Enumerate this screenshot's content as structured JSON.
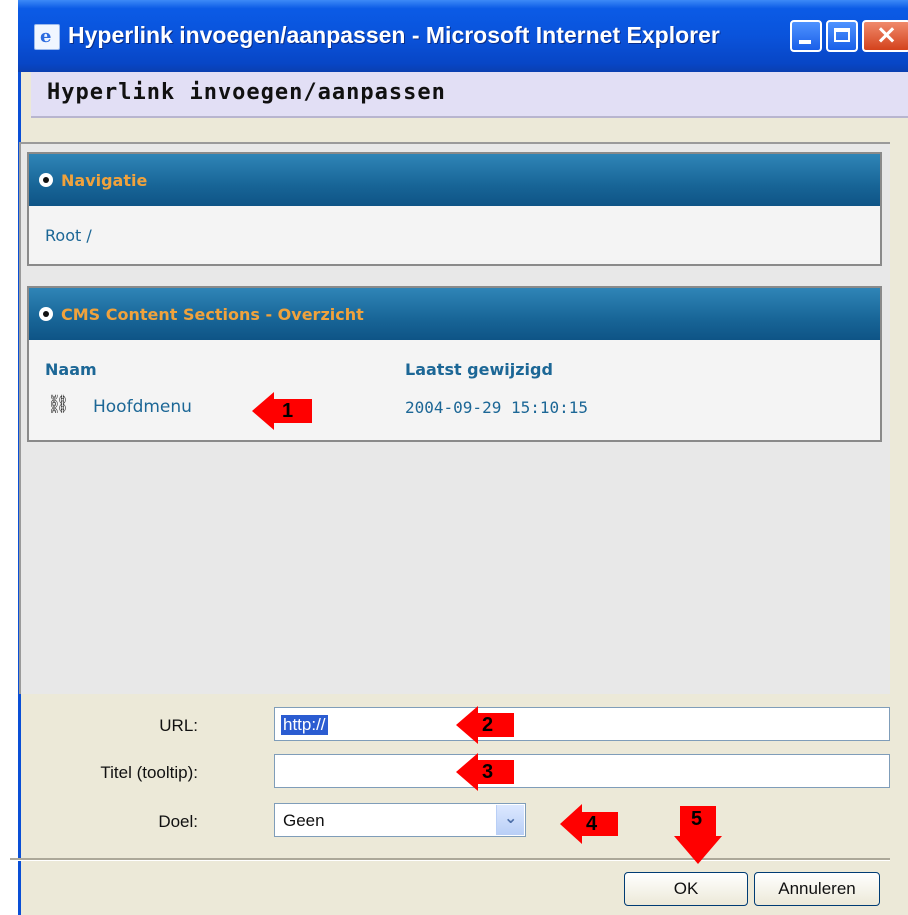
{
  "window": {
    "title": "Hyperlink invoegen/aanpassen - Microsoft Internet Explorer",
    "icon": "ie-page-icon"
  },
  "dialog": {
    "header": "Hyperlink invoegen/aanpassen"
  },
  "navigation_panel": {
    "title": "Navigatie",
    "breadcrumb": "Root /"
  },
  "cms_panel": {
    "title": "CMS Content Sections - Overzicht",
    "columns": [
      "Naam",
      "Laatst gewijzigd"
    ],
    "rows": [
      {
        "name": "Hoofdmenu",
        "modified": "2004-09-29 15:10:15",
        "icon": "link-icon"
      }
    ]
  },
  "form": {
    "url_label": "URL:",
    "url_value": "http://",
    "title_label": "Titel (tooltip):",
    "title_value": "",
    "target_label": "Doel:",
    "target_value": "Geen"
  },
  "buttons": {
    "ok": "OK",
    "cancel": "Annuleren"
  },
  "annotations": [
    "1",
    "2",
    "3",
    "4",
    "5"
  ],
  "colors": {
    "titlebar": "#0a53db",
    "panel_header": "#186597",
    "panel_title": "#f0a23c",
    "link_text": "#1c6796",
    "annotation": "#ff0000"
  }
}
